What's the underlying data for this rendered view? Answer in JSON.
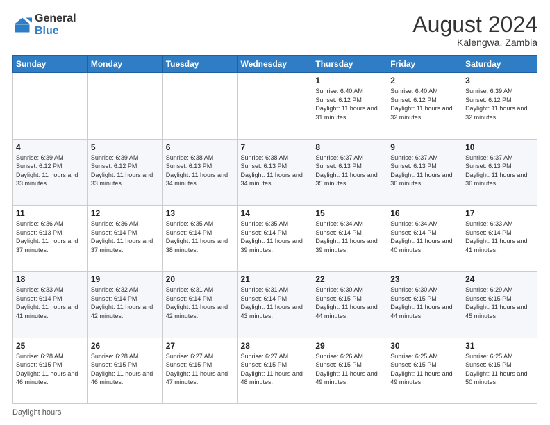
{
  "header": {
    "logo_general": "General",
    "logo_blue": "Blue",
    "month_year": "August 2024",
    "location": "Kalengwa, Zambia"
  },
  "footer": {
    "daylight_label": "Daylight hours"
  },
  "days_of_week": [
    "Sunday",
    "Monday",
    "Tuesday",
    "Wednesday",
    "Thursday",
    "Friday",
    "Saturday"
  ],
  "weeks": [
    [
      {
        "day": "",
        "info": ""
      },
      {
        "day": "",
        "info": ""
      },
      {
        "day": "",
        "info": ""
      },
      {
        "day": "",
        "info": ""
      },
      {
        "day": "1",
        "info": "Sunrise: 6:40 AM\nSunset: 6:12 PM\nDaylight: 11 hours and 31 minutes."
      },
      {
        "day": "2",
        "info": "Sunrise: 6:40 AM\nSunset: 6:12 PM\nDaylight: 11 hours and 32 minutes."
      },
      {
        "day": "3",
        "info": "Sunrise: 6:39 AM\nSunset: 6:12 PM\nDaylight: 11 hours and 32 minutes."
      }
    ],
    [
      {
        "day": "4",
        "info": "Sunrise: 6:39 AM\nSunset: 6:12 PM\nDaylight: 11 hours and 33 minutes."
      },
      {
        "day": "5",
        "info": "Sunrise: 6:39 AM\nSunset: 6:12 PM\nDaylight: 11 hours and 33 minutes."
      },
      {
        "day": "6",
        "info": "Sunrise: 6:38 AM\nSunset: 6:13 PM\nDaylight: 11 hours and 34 minutes."
      },
      {
        "day": "7",
        "info": "Sunrise: 6:38 AM\nSunset: 6:13 PM\nDaylight: 11 hours and 34 minutes."
      },
      {
        "day": "8",
        "info": "Sunrise: 6:37 AM\nSunset: 6:13 PM\nDaylight: 11 hours and 35 minutes."
      },
      {
        "day": "9",
        "info": "Sunrise: 6:37 AM\nSunset: 6:13 PM\nDaylight: 11 hours and 36 minutes."
      },
      {
        "day": "10",
        "info": "Sunrise: 6:37 AM\nSunset: 6:13 PM\nDaylight: 11 hours and 36 minutes."
      }
    ],
    [
      {
        "day": "11",
        "info": "Sunrise: 6:36 AM\nSunset: 6:13 PM\nDaylight: 11 hours and 37 minutes."
      },
      {
        "day": "12",
        "info": "Sunrise: 6:36 AM\nSunset: 6:14 PM\nDaylight: 11 hours and 37 minutes."
      },
      {
        "day": "13",
        "info": "Sunrise: 6:35 AM\nSunset: 6:14 PM\nDaylight: 11 hours and 38 minutes."
      },
      {
        "day": "14",
        "info": "Sunrise: 6:35 AM\nSunset: 6:14 PM\nDaylight: 11 hours and 39 minutes."
      },
      {
        "day": "15",
        "info": "Sunrise: 6:34 AM\nSunset: 6:14 PM\nDaylight: 11 hours and 39 minutes."
      },
      {
        "day": "16",
        "info": "Sunrise: 6:34 AM\nSunset: 6:14 PM\nDaylight: 11 hours and 40 minutes."
      },
      {
        "day": "17",
        "info": "Sunrise: 6:33 AM\nSunset: 6:14 PM\nDaylight: 11 hours and 41 minutes."
      }
    ],
    [
      {
        "day": "18",
        "info": "Sunrise: 6:33 AM\nSunset: 6:14 PM\nDaylight: 11 hours and 41 minutes."
      },
      {
        "day": "19",
        "info": "Sunrise: 6:32 AM\nSunset: 6:14 PM\nDaylight: 11 hours and 42 minutes."
      },
      {
        "day": "20",
        "info": "Sunrise: 6:31 AM\nSunset: 6:14 PM\nDaylight: 11 hours and 42 minutes."
      },
      {
        "day": "21",
        "info": "Sunrise: 6:31 AM\nSunset: 6:14 PM\nDaylight: 11 hours and 43 minutes."
      },
      {
        "day": "22",
        "info": "Sunrise: 6:30 AM\nSunset: 6:15 PM\nDaylight: 11 hours and 44 minutes."
      },
      {
        "day": "23",
        "info": "Sunrise: 6:30 AM\nSunset: 6:15 PM\nDaylight: 11 hours and 44 minutes."
      },
      {
        "day": "24",
        "info": "Sunrise: 6:29 AM\nSunset: 6:15 PM\nDaylight: 11 hours and 45 minutes."
      }
    ],
    [
      {
        "day": "25",
        "info": "Sunrise: 6:28 AM\nSunset: 6:15 PM\nDaylight: 11 hours and 46 minutes."
      },
      {
        "day": "26",
        "info": "Sunrise: 6:28 AM\nSunset: 6:15 PM\nDaylight: 11 hours and 46 minutes."
      },
      {
        "day": "27",
        "info": "Sunrise: 6:27 AM\nSunset: 6:15 PM\nDaylight: 11 hours and 47 minutes."
      },
      {
        "day": "28",
        "info": "Sunrise: 6:27 AM\nSunset: 6:15 PM\nDaylight: 11 hours and 48 minutes."
      },
      {
        "day": "29",
        "info": "Sunrise: 6:26 AM\nSunset: 6:15 PM\nDaylight: 11 hours and 49 minutes."
      },
      {
        "day": "30",
        "info": "Sunrise: 6:25 AM\nSunset: 6:15 PM\nDaylight: 11 hours and 49 minutes."
      },
      {
        "day": "31",
        "info": "Sunrise: 6:25 AM\nSunset: 6:15 PM\nDaylight: 11 hours and 50 minutes."
      }
    ]
  ]
}
